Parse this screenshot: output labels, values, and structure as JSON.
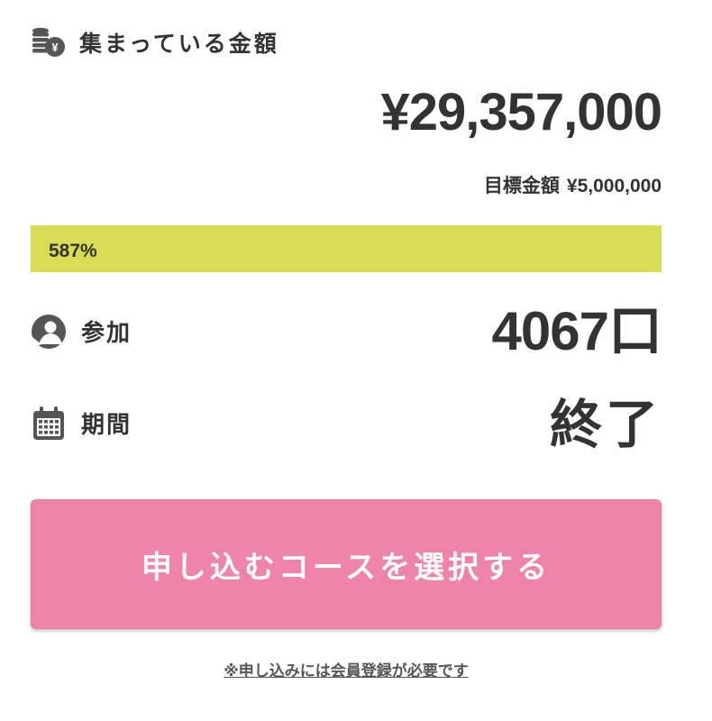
{
  "collected": {
    "label": "集まっている金額",
    "amount": "¥29,357,000",
    "icon": "coins-yen-icon"
  },
  "goal": {
    "label": "目標金額",
    "amount": "¥5,000,000"
  },
  "progress": {
    "percent_label": "587%",
    "percent": 587,
    "fill_color": "#d9dd55"
  },
  "participants": {
    "label": "参加",
    "value": "4067口",
    "icon": "person-icon"
  },
  "period": {
    "label": "期間",
    "value": "終了",
    "icon": "calendar-icon"
  },
  "cta": {
    "label": "申し込むコースを選択する",
    "color": "#ef83aa"
  },
  "note": {
    "text": "※申し込みには会員登録が必要です"
  }
}
